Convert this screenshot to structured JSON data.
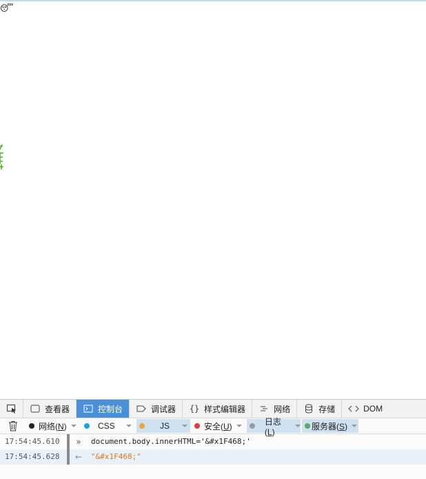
{
  "page": {
    "emoji": "😴"
  },
  "devtools": {
    "tabs": [
      {
        "label": "查看器",
        "icon": "inspector-icon"
      },
      {
        "label": "控制台",
        "icon": "console-icon",
        "active": true
      },
      {
        "label": "调试器",
        "icon": "debugger-icon"
      },
      {
        "label": "样式编辑器",
        "icon": "braces-icon"
      },
      {
        "label": "网络",
        "icon": "network-icon"
      },
      {
        "label": "存储",
        "icon": "storage-icon"
      },
      {
        "label": "DOM",
        "icon": "dom-icon"
      }
    ],
    "filters": {
      "net": {
        "label": "网络(",
        "key": "N",
        "suffix": ")",
        "color": "#222222"
      },
      "css": {
        "label": "CSS",
        "color": "#1aa2d9"
      },
      "js": {
        "label": "JS",
        "color": "#e8a33d"
      },
      "security": {
        "label": "安全(",
        "key": "U",
        "suffix": ")",
        "color": "#e3393c"
      },
      "log": {
        "label": "日志(",
        "key": "L",
        "suffix": ")",
        "color": "#9a9a9a"
      },
      "server": {
        "label": "服务器(",
        "key": "S",
        "suffix": ")",
        "color": "#5fa86b"
      }
    },
    "log": [
      {
        "time": "17:54:45.610",
        "arrow": "»",
        "text": "document.body.innerHTML='&#x1F468;'"
      },
      {
        "time": "17:54:45.628",
        "arrow": "←",
        "text": "\"&#x1F468;\""
      }
    ]
  },
  "colors": {
    "accent": "#4a90d9",
    "edge_mark": "#4caf2a"
  }
}
